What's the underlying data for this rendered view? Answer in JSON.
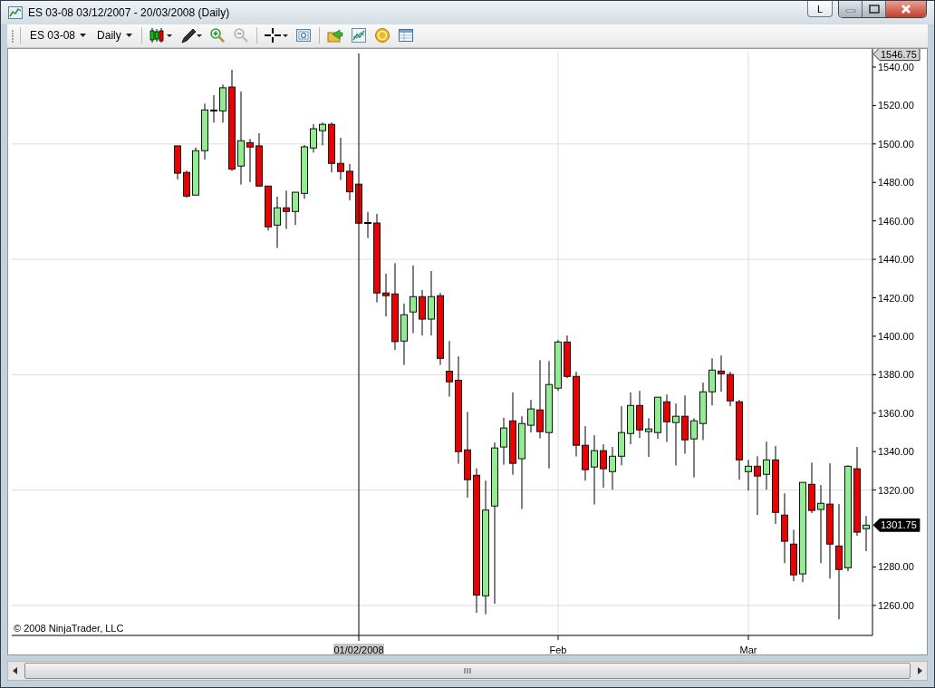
{
  "window": {
    "title": "ES 03-08  03/12/2007 - 20/03/2008 (Daily)",
    "extra_button": "L"
  },
  "toolbar": {
    "instrument": "ES 03-08",
    "interval": "Daily"
  },
  "chart": {
    "copyright": "© 2008 NinjaTrader, LLC",
    "chart_data": {
      "type": "candlestick",
      "grid": true,
      "ylim": [
        1244.4,
        1548.0
      ],
      "yticks": [
        {
          "value": 1260,
          "label": "1260.00"
        },
        {
          "value": 1280,
          "label": "1280.00"
        },
        {
          "value": 1320,
          "label": "1320.00"
        },
        {
          "value": 1340,
          "label": "1340.00"
        },
        {
          "value": 1360,
          "label": "1360.00"
        },
        {
          "value": 1380,
          "label": "1380.00"
        },
        {
          "value": 1400,
          "label": "1400.00"
        },
        {
          "value": 1420,
          "label": "1420.00"
        },
        {
          "value": 1440,
          "label": "1440.00"
        },
        {
          "value": 1460,
          "label": "1460.00"
        },
        {
          "value": 1480,
          "label": "1480.00"
        },
        {
          "value": 1500,
          "label": "1500.00"
        },
        {
          "value": 1520,
          "label": "1520.00"
        },
        {
          "value": 1540,
          "label": "1540.00"
        }
      ],
      "categories": [
        null,
        null,
        null,
        null,
        null,
        null,
        null,
        null,
        null,
        null,
        null,
        null,
        null,
        null,
        null,
        null,
        null,
        null,
        null,
        null,
        "01/02/2008",
        null,
        null,
        null,
        null,
        null,
        null,
        null,
        null,
        null,
        null,
        null,
        null,
        null,
        null,
        null,
        null,
        null,
        null,
        null,
        null,
        null,
        "Feb",
        null,
        null,
        null,
        null,
        null,
        null,
        null,
        null,
        null,
        null,
        null,
        null,
        null,
        null,
        null,
        null,
        null,
        null,
        null,
        null,
        "Mar",
        null,
        null,
        null,
        null,
        null,
        null,
        null,
        null,
        null,
        null,
        null,
        null,
        null
      ],
      "ref_lines": [
        {
          "axis": "x",
          "value": "01/02/2008"
        }
      ],
      "ohlc": [
        [
          1499.0,
          1499.0,
          1481.5,
          1484.8
        ],
        [
          1485.2,
          1486.1,
          1472.0,
          1472.9
        ],
        [
          1473.4,
          1498.2,
          1473.4,
          1496.5
        ],
        [
          1496.5,
          1521.0,
          1491.9,
          1517.7
        ],
        [
          1517.4,
          1525.4,
          1511.1,
          1517.4
        ],
        [
          1517.2,
          1530.9,
          1511.1,
          1529.2
        ],
        [
          1529.6,
          1538.6,
          1486.0,
          1486.9
        ],
        [
          1488.5,
          1527.3,
          1478.9,
          1501.7
        ],
        [
          1500.7,
          1502.6,
          1480.1,
          1498.4
        ],
        [
          1499.0,
          1505.6,
          1478.1,
          1478.1
        ],
        [
          1478.1,
          1478.1,
          1455.0,
          1456.9
        ],
        [
          1457.8,
          1472.6,
          1445.9,
          1466.8
        ],
        [
          1466.8,
          1475.7,
          1455.8,
          1464.9
        ],
        [
          1464.9,
          1474.9,
          1457.8,
          1474.9
        ],
        [
          1474.3,
          1499.5,
          1471.5,
          1498.5
        ],
        [
          1497.9,
          1510.3,
          1495.5,
          1507.9
        ],
        [
          1506.9,
          1511.2,
          1499.3,
          1510.2
        ],
        [
          1510.2,
          1511.2,
          1485.2,
          1489.9
        ],
        [
          1489.9,
          1503.2,
          1481.3,
          1485.7
        ],
        [
          1485.8,
          1489.6,
          1470.7,
          1475.1
        ],
        [
          1479.1,
          1479.1,
          1458.8,
          1458.8
        ],
        [
          1458.9,
          1464.7,
          1451.1,
          1458.9
        ],
        [
          1458.9,
          1463.6,
          1417.6,
          1422.5
        ],
        [
          1422.5,
          1432.5,
          1410.3,
          1421.1
        ],
        [
          1422.0,
          1438.0,
          1392.9,
          1397.2
        ],
        [
          1397.5,
          1417.0,
          1385.1,
          1411.2
        ],
        [
          1412.6,
          1436.8,
          1401.6,
          1420.6
        ],
        [
          1420.6,
          1424.0,
          1400.4,
          1408.9
        ],
        [
          1408.9,
          1433.9,
          1400.4,
          1420.6
        ],
        [
          1421.1,
          1422.5,
          1385.1,
          1388.5
        ],
        [
          1381.8,
          1397.5,
          1368.6,
          1376.3
        ],
        [
          1377.1,
          1389.5,
          1333.7,
          1340.0
        ],
        [
          1340.9,
          1360.7,
          1316.0,
          1325.4
        ],
        [
          1327.7,
          1331.3,
          1256.2,
          1265.4
        ],
        [
          1265.0,
          1324.9,
          1255.4,
          1309.6
        ],
        [
          1311.7,
          1344.7,
          1260.9,
          1341.9
        ],
        [
          1342.4,
          1357.6,
          1333.2,
          1352.3
        ],
        [
          1356.0,
          1370.8,
          1328.0,
          1333.9
        ],
        [
          1336.3,
          1358.4,
          1310.1,
          1354.6
        ],
        [
          1353.7,
          1366.9,
          1350.0,
          1362.2
        ],
        [
          1361.7,
          1387.6,
          1346.9,
          1350.4
        ],
        [
          1349.9,
          1387.1,
          1331.3,
          1374.9
        ],
        [
          1373.0,
          1398.0,
          1371.6,
          1397.0
        ],
        [
          1397.0,
          1400.4,
          1378.2,
          1379.1
        ],
        [
          1379.1,
          1381.5,
          1337.5,
          1343.3
        ],
        [
          1343.3,
          1353.2,
          1324.9,
          1330.6
        ],
        [
          1332.0,
          1348.5,
          1312.5,
          1340.5
        ],
        [
          1340.5,
          1343.8,
          1321.2,
          1331.1
        ],
        [
          1329.6,
          1342.4,
          1320.2,
          1337.6
        ],
        [
          1337.6,
          1363.6,
          1332.9,
          1349.9
        ],
        [
          1349.4,
          1370.8,
          1343.8,
          1364.0
        ],
        [
          1364.0,
          1371.6,
          1347.1,
          1351.3
        ],
        [
          1350.4,
          1357.4,
          1337.2,
          1351.8
        ],
        [
          1349.9,
          1368.3,
          1346.6,
          1368.3
        ],
        [
          1365.9,
          1369.7,
          1345.0,
          1355.5
        ],
        [
          1355.1,
          1365.0,
          1332.8,
          1358.4
        ],
        [
          1358.4,
          1369.2,
          1338.9,
          1346.1
        ],
        [
          1346.6,
          1357.4,
          1326.6,
          1356.0
        ],
        [
          1354.6,
          1375.9,
          1346.0,
          1371.1
        ],
        [
          1371.1,
          1388.5,
          1364.0,
          1382.4
        ],
        [
          1381.9,
          1390.0,
          1371.1,
          1380.5
        ],
        [
          1380.1,
          1381.5,
          1363.6,
          1366.4
        ],
        [
          1365.9,
          1366.9,
          1325.4,
          1335.7
        ],
        [
          1329.6,
          1335.7,
          1319.8,
          1332.4
        ],
        [
          1332.4,
          1337.6,
          1307.1,
          1327.3
        ],
        [
          1328.2,
          1345.2,
          1320.2,
          1335.7
        ],
        [
          1335.7,
          1342.9,
          1302.4,
          1308.4
        ],
        [
          1307.0,
          1318.3,
          1282.0,
          1293.4
        ],
        [
          1291.9,
          1299.4,
          1272.6,
          1275.9
        ],
        [
          1276.4,
          1324.0,
          1272.1,
          1324.0
        ],
        [
          1323.0,
          1334.3,
          1308.0,
          1309.4
        ],
        [
          1309.9,
          1322.6,
          1282.0,
          1313.1
        ],
        [
          1312.7,
          1333.9,
          1274.0,
          1291.9
        ],
        [
          1290.9,
          1312.7,
          1252.8,
          1278.7
        ],
        [
          1279.6,
          1332.9,
          1277.8,
          1332.4
        ],
        [
          1331.1,
          1342.4,
          1296.2,
          1298.1
        ],
        [
          1299.9,
          1306.5,
          1288.2,
          1301.75
        ]
      ],
      "annotations": [
        "1546.75",
        "1301.75"
      ]
    }
  }
}
